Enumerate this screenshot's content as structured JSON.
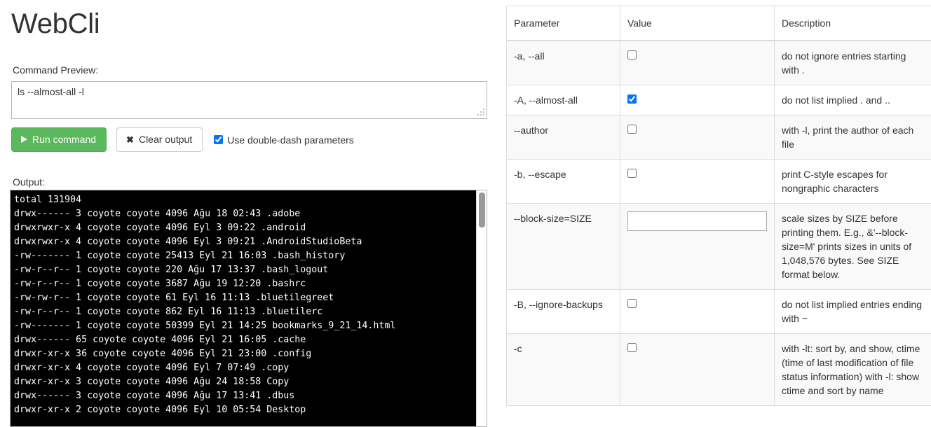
{
  "app": {
    "title": "WebCli"
  },
  "command_preview": {
    "label": "Command Preview:",
    "value": "ls --almost-all -l",
    "placeholder": ""
  },
  "toolbar": {
    "run_label": "Run command",
    "clear_label": "Clear output",
    "double_dash_label": "Use double-dash parameters",
    "double_dash_checked": true,
    "run_icon": "play-icon",
    "clear_icon": "close-x-icon",
    "run_color": "#5cb85c"
  },
  "output": {
    "label": "Output:",
    "background": "#000000",
    "foreground": "#ffffff",
    "text": "total 131904\ndrwx------ 3 coyote coyote 4096 Ağu 18 02:43 .adobe\ndrwxrwxr-x 4 coyote coyote 4096 Eyl 3 09:22 .android\ndrwxrwxr-x 4 coyote coyote 4096 Eyl 3 09:21 .AndroidStudioBeta\n-rw------- 1 coyote coyote 25413 Eyl 21 16:03 .bash_history\n-rw-r--r-- 1 coyote coyote 220 Ağu 17 13:37 .bash_logout\n-rw-r--r-- 1 coyote coyote 3687 Ağu 19 12:20 .bashrc\n-rw-rw-r-- 1 coyote coyote 61 Eyl 16 11:13 .bluetilegreet\n-rw-r--r-- 1 coyote coyote 862 Eyl 16 11:13 .bluetilerc\n-rw------- 1 coyote coyote 50399 Eyl 21 14:25 bookmarks_9_21_14.html\ndrwx------ 65 coyote coyote 4096 Eyl 21 16:05 .cache\ndrwxr-xr-x 36 coyote coyote 4096 Eyl 21 23:00 .config\ndrwxr-xr-x 4 coyote coyote 4096 Eyl 7 07:49 .copy\ndrwxr-xr-x 3 coyote coyote 4096 Ağu 24 18:58 Copy\ndrwx------ 3 coyote coyote 4096 Ağu 17 13:41 .dbus\ndrwxr-xr-x 2 coyote coyote 4096 Eyl 10 05:54 Desktop"
  },
  "params_table": {
    "headers": [
      "Parameter",
      "Value",
      "Description"
    ],
    "rows": [
      {
        "param": "-a, --all",
        "control": "checkbox",
        "checked": false,
        "description": "do not ignore entries starting with ."
      },
      {
        "param": "-A, --almost-all",
        "control": "checkbox",
        "checked": true,
        "description": "do not list implied . and .."
      },
      {
        "param": "--author",
        "control": "checkbox",
        "checked": false,
        "description": "with -l, print the author of each file"
      },
      {
        "param": "-b, --escape",
        "control": "checkbox",
        "checked": false,
        "description": "print C-style escapes for nongraphic characters"
      },
      {
        "param": "--block-size=SIZE",
        "control": "text",
        "value": "",
        "placeholder": "",
        "description": "scale sizes by SIZE before printing them. E.g., &'--block-size=M' prints sizes in units of 1,048,576 bytes. See SIZE format below."
      },
      {
        "param": "-B, --ignore-backups",
        "control": "checkbox",
        "checked": false,
        "description": "do not list implied entries ending with ~"
      },
      {
        "param": "-c",
        "control": "checkbox",
        "checked": false,
        "description": "with -lt: sort by, and show, ctime (time of last modification of file status information) with -l: show ctime and sort by name"
      }
    ]
  }
}
